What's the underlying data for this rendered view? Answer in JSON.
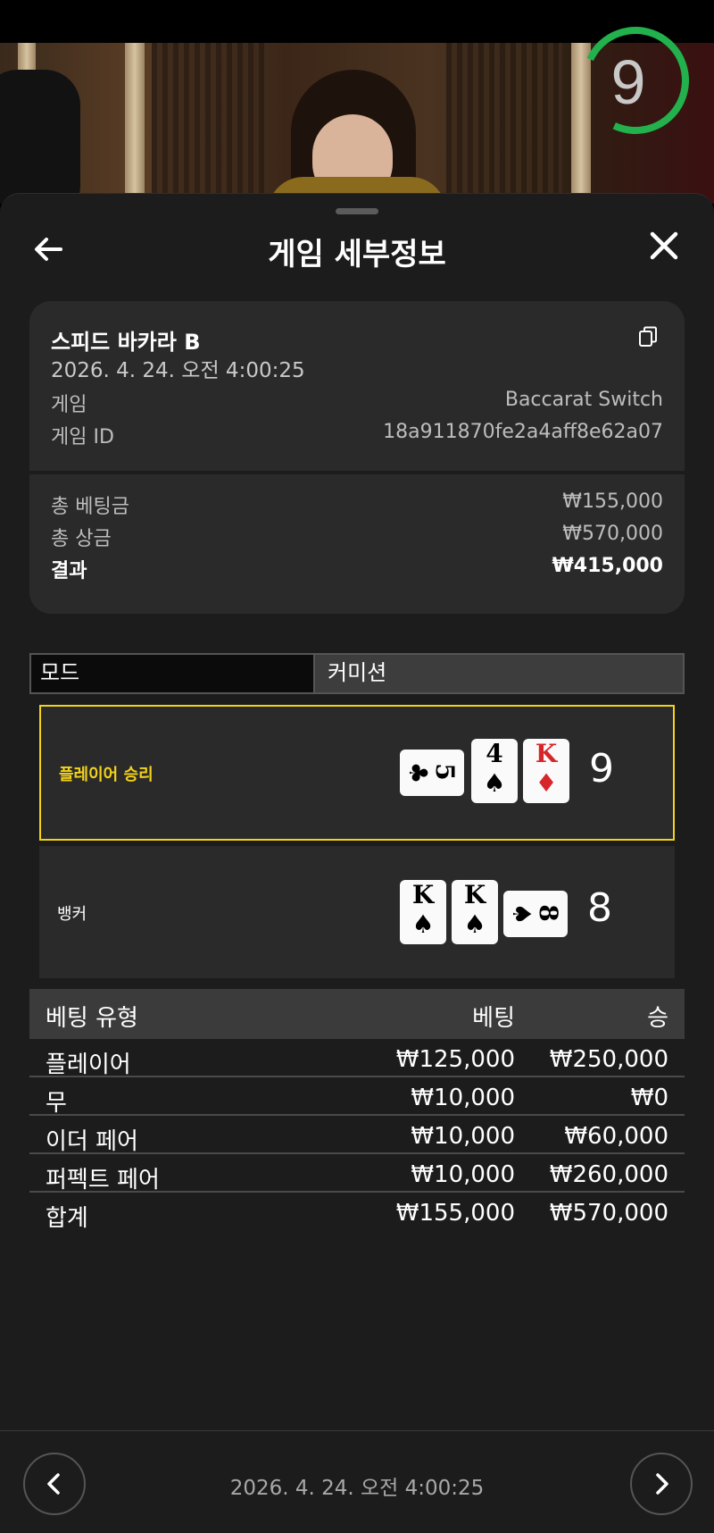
{
  "header": {
    "title": "게임 세부정보"
  },
  "timer": {
    "value": "9"
  },
  "card": {
    "title": "스피드 바카라 B",
    "datetime": "2026. 4. 24. 오전 4:00:25",
    "game_label": "게임",
    "game_value": "Baccarat Switch",
    "game_id_label": "게임 ID",
    "game_id_value": "18a911870fe2a4aff8e62a07",
    "total_bet_label": "총 베팅금",
    "total_bet_value": "₩155,000",
    "total_win_label": "총 상금",
    "total_win_value": "₩570,000",
    "result_label": "결과",
    "result_value": "₩415,000"
  },
  "tabs": {
    "mode": "모드",
    "commission": "커미션"
  },
  "hands": {
    "player": {
      "label": "플레이어 승리",
      "score": "9",
      "cards": [
        {
          "rank": "5",
          "suit": "♣",
          "color": "black",
          "orientation": "horizontal"
        },
        {
          "rank": "4",
          "suit": "♠",
          "color": "black",
          "orientation": "vertical"
        },
        {
          "rank": "K",
          "suit": "♦",
          "color": "red",
          "orientation": "vertical"
        }
      ]
    },
    "banker": {
      "label": "뱅커",
      "score": "8",
      "cards": [
        {
          "rank": "K",
          "suit": "♠",
          "color": "black",
          "orientation": "vertical"
        },
        {
          "rank": "K",
          "suit": "♠",
          "color": "black",
          "orientation": "vertical"
        },
        {
          "rank": "8",
          "suit": "♠",
          "color": "black",
          "orientation": "horizontal"
        }
      ]
    }
  },
  "bets": {
    "headers": [
      "베팅 유형",
      "베팅",
      "승"
    ],
    "rows": [
      [
        "플레이어",
        "₩125,000",
        "₩250,000"
      ],
      [
        "무",
        "₩10,000",
        "₩0"
      ],
      [
        "이더 페어",
        "₩10,000",
        "₩60,000"
      ],
      [
        "퍼펙트 페어",
        "₩10,000",
        "₩260,000"
      ],
      [
        "합계",
        "₩155,000",
        "₩570,000"
      ]
    ]
  },
  "footer": {
    "datetime": "2026. 4. 24. 오전 4:00:25"
  },
  "colors": {
    "highlight": "#f2d21b",
    "timer": "#22b14c",
    "sheet": "#1c1c1c"
  },
  "icons": {
    "back": "arrow-left-icon",
    "close": "close-icon",
    "copy": "copy-icon",
    "prev": "chevron-left-icon",
    "next": "chevron-right-icon"
  }
}
